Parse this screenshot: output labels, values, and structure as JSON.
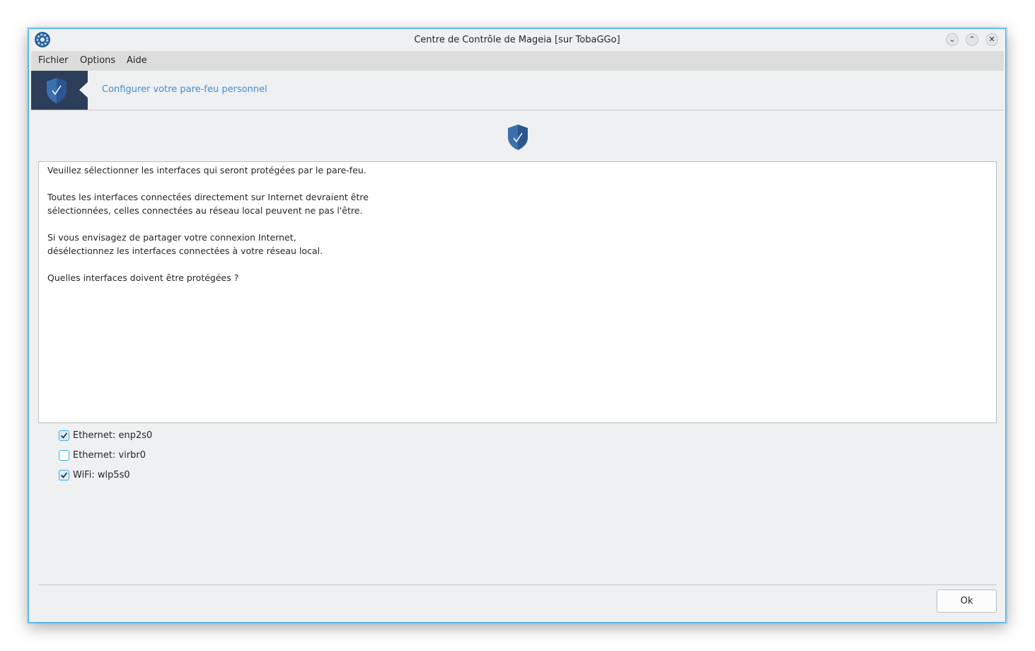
{
  "window": {
    "title": "Centre de Contrôle de Mageia [sur TobaGGo]",
    "buttons": {
      "minimize": "⌄",
      "maximize": "⌃",
      "close": "✕"
    }
  },
  "menubar": {
    "items": [
      "Fichier",
      "Options",
      "Aide"
    ]
  },
  "banner": {
    "title": "Configurer votre pare-feu personnel",
    "icon": "shield-check-icon"
  },
  "main": {
    "description": [
      "Veuillez sélectionner les interfaces qui seront protégées par le pare-feu.",
      "",
      "Toutes les interfaces connectées directement sur Internet devraient être",
      "sélectionnées, celles connectées au réseau local peuvent ne pas l'être.",
      "",
      "Si vous envisagez de partager votre connexion Internet,",
      "désélectionnez les interfaces connectées à votre réseau local.",
      "",
      "Quelles interfaces doivent être protégées ?"
    ],
    "interfaces": [
      {
        "label": "Ethernet: enp2s0",
        "checked": true
      },
      {
        "label": "Ethernet: virbr0",
        "checked": false
      },
      {
        "label": "WiFi: wlp5s0",
        "checked": true
      }
    ]
  },
  "footer": {
    "ok_label": "Ok"
  },
  "colors": {
    "accent": "#3daee9",
    "banner_dark": "#2c3e5a",
    "link": "#3d8fd6"
  }
}
